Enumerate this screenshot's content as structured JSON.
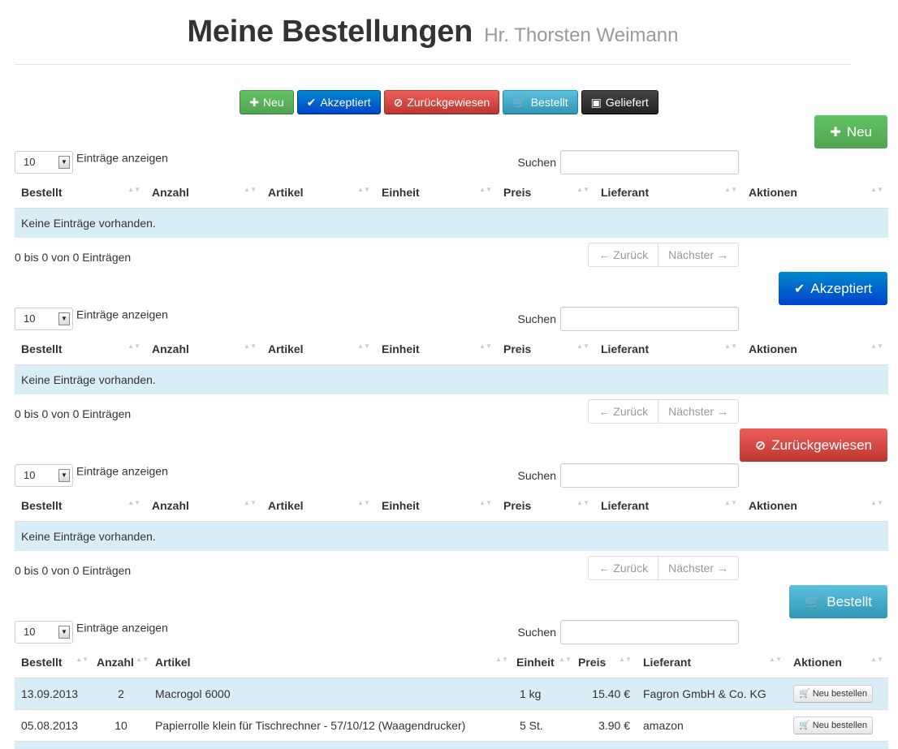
{
  "header": {
    "title": "Meine Bestellungen",
    "subtitle": "Hr. Thorsten Weimann"
  },
  "filters": [
    {
      "icon": "✚",
      "label": "Neu"
    },
    {
      "icon": "✔",
      "label": "Akzeptiert"
    },
    {
      "icon": "⊘",
      "label": "Zurückgewiesen"
    },
    {
      "icon": "🛒",
      "label": "Bestellt"
    },
    {
      "icon": "▣",
      "label": "Geliefert"
    }
  ],
  "common": {
    "length_value": "10",
    "length_label": "Einträge anzeigen",
    "search_label": "Suchen",
    "empty_text": "Keine Einträge vorhanden.",
    "info_text": "0 bis 0 von 0 Einträgen",
    "prev_label": "← Zurück",
    "next_label": "Nächster →",
    "columns": [
      "Bestellt",
      "Anzahl",
      "Artikel",
      "Einheit",
      "Preis",
      "Lieferant",
      "Aktionen"
    ],
    "sort_icon": "▲▼",
    "dropdown_icon": "▼"
  },
  "sections": [
    {
      "button_icon": "✚",
      "button_label": "Neu"
    },
    {
      "button_icon": "✔",
      "button_label": "Akzeptiert"
    },
    {
      "button_icon": "⊘",
      "button_label": "Zurückgewiesen"
    },
    {
      "button_icon": "🛒",
      "button_label": "Bestellt"
    }
  ],
  "ordered_rows": [
    {
      "date": "13.09.2013",
      "qty": "2",
      "article": "Macrogol 6000",
      "unit": "1 kg",
      "price": "15.40 €",
      "supplier": "Fagron GmbH & Co. KG",
      "action_icon": "🛒",
      "action": "Neu bestellen"
    },
    {
      "date": "05.08.2013",
      "qty": "10",
      "article": "Papierrolle klein für Tischrechner - 57/10/12 (Waagendrucker)",
      "unit": "5 St.",
      "price": "3.90 €",
      "supplier": "amazon",
      "action_icon": "🛒",
      "action": "Neu bestellen"
    }
  ]
}
